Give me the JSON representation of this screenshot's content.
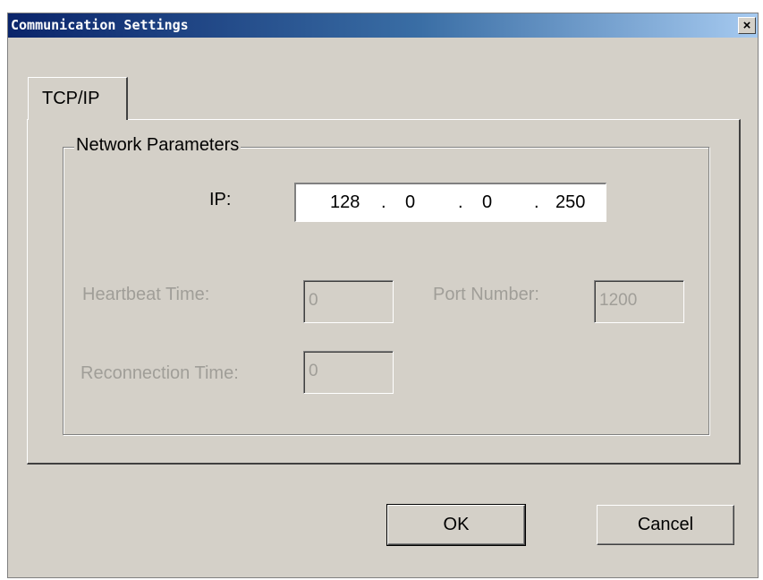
{
  "window": {
    "title": "Communication Settings",
    "close_glyph": "×"
  },
  "tabs": [
    {
      "label": "TCP/IP"
    }
  ],
  "group": {
    "title": "Network Parameters"
  },
  "ip": {
    "label": "IP:",
    "octets": [
      "128",
      "0",
      "0",
      "250"
    ],
    "separator": "."
  },
  "heartbeat": {
    "label": "Heartbeat Time:",
    "value": "0",
    "disabled": true
  },
  "port": {
    "label": "Port Number:",
    "value": "1200",
    "disabled": true
  },
  "reconnection": {
    "label": "Reconnection Time:",
    "value": "0",
    "disabled": true
  },
  "buttons": {
    "ok": "OK",
    "cancel": "Cancel"
  },
  "colors": {
    "title_start": "#0a246a",
    "title_end": "#a6caf0",
    "face": "#d4d0c8",
    "disabled_text": "#a09e98"
  },
  "icons": {
    "close": "close-icon"
  }
}
